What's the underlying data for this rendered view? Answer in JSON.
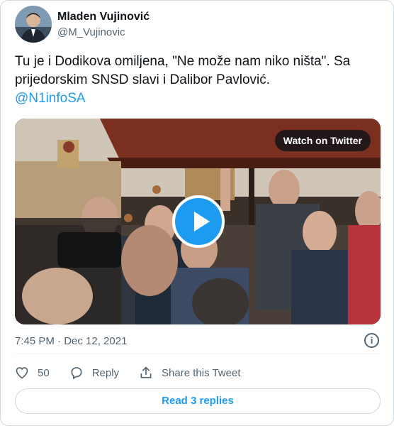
{
  "author": {
    "name": "Mladen Vujinović",
    "handle": "@M_Vujinovic"
  },
  "tweet": {
    "text": "Tu je i Dodikova omiljena, \"Ne može nam niko ništa\". Sa prijedorskim SNSD slavi i Dalibor Pavlović.",
    "mention": "@N1infoSA"
  },
  "media": {
    "watch_label": "Watch on Twitter"
  },
  "meta": {
    "timestamp": "7:45 PM · Dec 12, 2021",
    "info_icon": "i"
  },
  "actions": {
    "likes_count": "50",
    "reply_label": "Reply",
    "share_label": "Share this Tweet"
  },
  "replies_button": "Read 3 replies",
  "colors": {
    "accent": "#1d9bf0",
    "text": "#0f1419",
    "secondary": "#536471",
    "border": "#cfd9de"
  },
  "icons": [
    "heart-icon",
    "reply-icon",
    "share-icon",
    "info-icon",
    "play-icon"
  ]
}
